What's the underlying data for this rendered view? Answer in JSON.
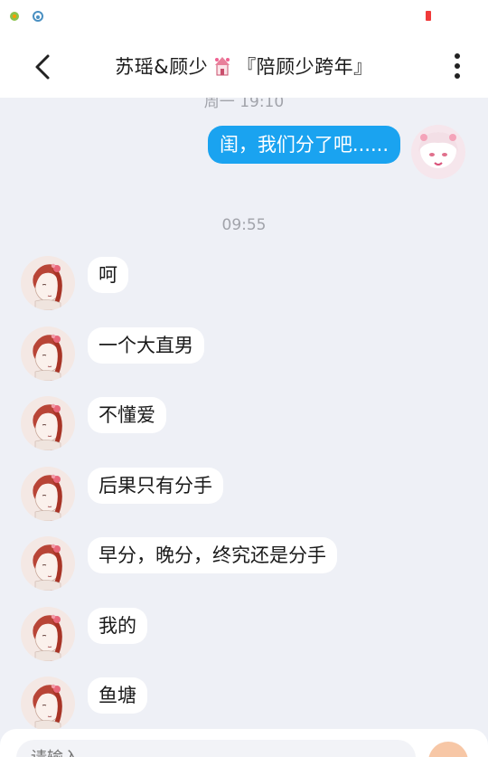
{
  "status_bar": {
    "icons": [
      "app-notification-icon",
      "app-notification-icon-2"
    ],
    "battery_color": "#f03a3a"
  },
  "header": {
    "title_prefix": "苏瑶&顾少",
    "title_suffix": "『陪顾少跨年』",
    "back_icon": "chevron-left-icon",
    "more_icon": "more-vertical-icon"
  },
  "chat": {
    "partial_timestamp": "周一 19:10",
    "outgoing": {
      "text": "闺，我们分了吧......"
    },
    "timestamp": "09:55",
    "incoming": [
      {
        "text": "呵"
      },
      {
        "text": "一个大直男"
      },
      {
        "text": "不懂爱"
      },
      {
        "text": "后果只有分手"
      },
      {
        "text": "早分，晚分，终究还是分手"
      },
      {
        "text": "我的"
      },
      {
        "text": "鱼塘"
      }
    ]
  },
  "input": {
    "placeholder": "请输入..."
  },
  "colors": {
    "background": "#eef0f6",
    "outgoing_bubble": "#1aa3f0",
    "incoming_bubble": "#ffffff",
    "timestamp": "#a1a3aa"
  }
}
